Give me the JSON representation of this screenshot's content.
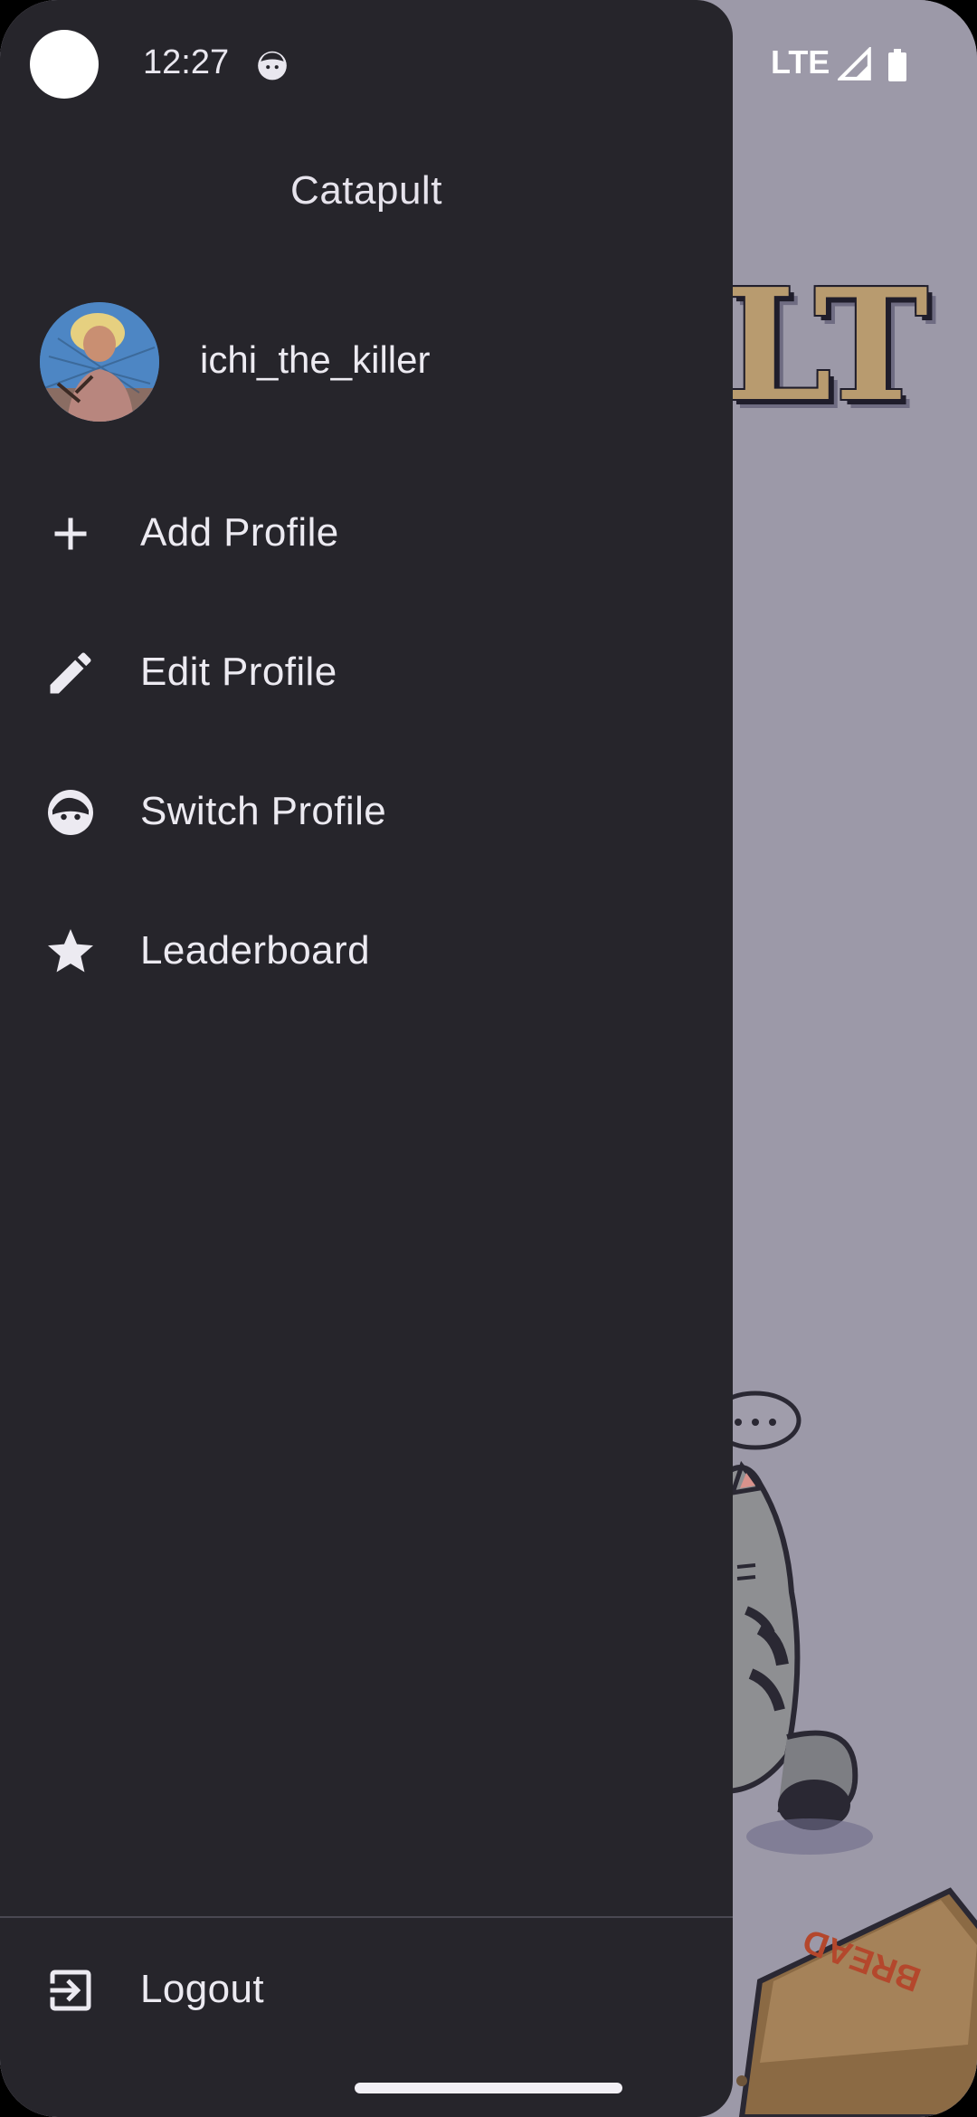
{
  "status_bar": {
    "time": "12:27",
    "network": "LTE",
    "app_icon": "cat-face-icon",
    "signal_icon": "signal-icon",
    "battery_icon": "battery-icon"
  },
  "background_app": {
    "logo_fragment": "LT"
  },
  "drawer": {
    "title": "Catapult",
    "profile": {
      "username": "ichi_the_killer",
      "avatar": "avatar"
    },
    "menu": [
      {
        "label": "Add Profile",
        "icon": "plus-icon"
      },
      {
        "label": "Edit Profile",
        "icon": "pencil-icon"
      },
      {
        "label": "Switch Profile",
        "icon": "face-icon"
      },
      {
        "label": "Leaderboard",
        "icon": "star-icon"
      }
    ],
    "footer": {
      "label": "Logout",
      "icon": "logout-icon"
    }
  },
  "colors": {
    "drawer_bg": "#26252b",
    "background_bg": "#9c99a8",
    "text": "#eceaf1",
    "logo": "#b89b6f"
  }
}
